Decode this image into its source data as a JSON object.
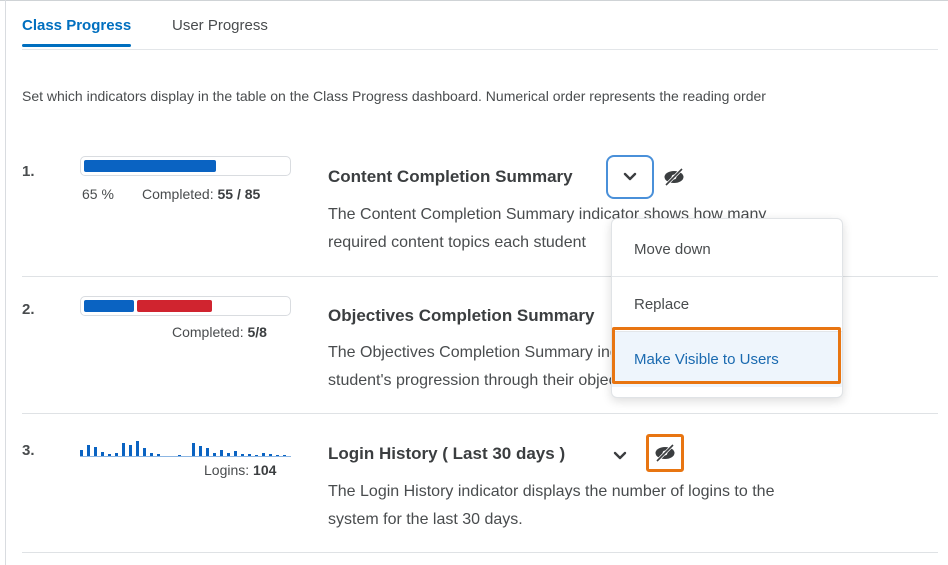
{
  "tabs": [
    {
      "label": "Class Progress",
      "active": true
    },
    {
      "label": "User Progress",
      "active": false
    }
  ],
  "description": "Set which indicators display in the table on the Class Progress dashboard. Numerical order represents the reading order",
  "indicators": [
    {
      "number": "1.",
      "percent_label": "65 %",
      "completed_label": "Completed:",
      "completed_value": "55 / 85",
      "progress_fraction": 0.65,
      "title": "Content Completion Summary",
      "desc_line1": "The Content Completion Summary indicator shows how many",
      "desc_line2": "required content topics each student"
    },
    {
      "number": "2.",
      "completed_label": "Completed:",
      "completed_value": "5/8",
      "segment_values": [
        2,
        3
      ],
      "title": "Objectives Completion Summary",
      "desc_line1": "The Objectives Completion Summary indicator shows each",
      "desc_line2": "student's progression through their objectives."
    },
    {
      "number": "3.",
      "logins_label": "Logins:",
      "logins_value": "104",
      "sparkline": [
        6,
        10,
        8,
        4,
        2,
        3,
        12,
        10,
        14,
        7,
        3,
        2,
        0,
        0,
        1,
        0,
        12,
        9,
        7,
        3,
        6,
        3,
        5,
        2,
        2,
        1,
        3,
        2,
        1,
        1
      ],
      "title": "Login History ( Last 30 days )",
      "desc_line1": "The Login History indicator displays the number of logins to the",
      "desc_line2": "system for the last 30 days."
    }
  ],
  "menu": {
    "items": [
      {
        "label": "Move down"
      },
      {
        "label": "Replace"
      },
      {
        "label": "Make Visible to Users",
        "highlighted": true
      }
    ]
  },
  "colors": {
    "accent": "#006fbf",
    "blue_bar": "#0a63c2",
    "red_bar": "#d0242f",
    "highlight_outline": "#e87511"
  },
  "icons": {
    "dropdown": "chevron-down-icon",
    "visibility": "eye-hidden-icon"
  }
}
